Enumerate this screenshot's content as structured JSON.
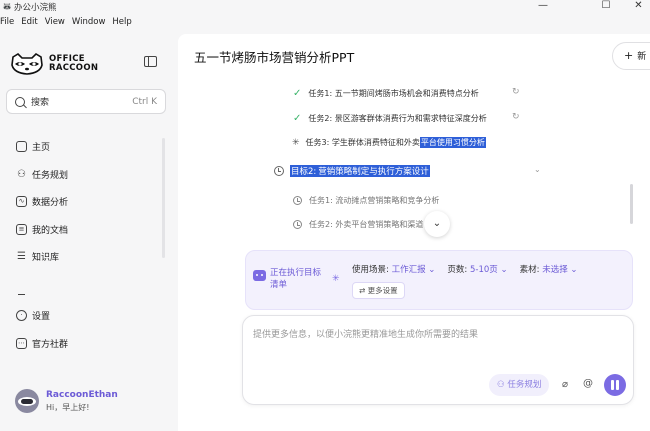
{
  "window": {
    "title": "办公小浣熊",
    "controls": [
      "—",
      "☐",
      "✕"
    ]
  },
  "menu": [
    "File",
    "Edit",
    "View",
    "Window",
    "Help"
  ],
  "sidebar": {
    "brand_line1": "OFFICE",
    "brand_line2": "RACCOON",
    "search_label": "搜索",
    "search_shortcut": "Ctrl K",
    "nav": [
      {
        "label": "主页",
        "icon": "home-icon"
      },
      {
        "label": "任务规划",
        "icon": "task-plan-icon"
      },
      {
        "label": "数据分析",
        "icon": "data-analysis-icon"
      },
      {
        "label": "我的文档",
        "icon": "document-icon"
      },
      {
        "label": "知识库",
        "icon": "knowledge-base-icon"
      }
    ],
    "bottom_nav": [
      {
        "label": "设置",
        "icon": "settings-icon"
      },
      {
        "label": "官方社群",
        "icon": "community-icon"
      }
    ],
    "user": {
      "name": "RaccoonEthan",
      "greeting": "Hi，早上好!"
    }
  },
  "main": {
    "title": "五一节烤肠市场营销分析PPT",
    "new_button": "新",
    "tasks_goal1": [
      {
        "text": "任务1: 五一节期间烤肠市场机会和消费特点分析",
        "status": "done"
      },
      {
        "text": "任务2: 景区游客群体消费行为和需求特征深度分析",
        "status": "done"
      },
      {
        "text_plain": "任务3: 学生群体消费特征和外卖",
        "text_hl": "平台使用习惯分析",
        "status": "running"
      }
    ],
    "goal2": {
      "prefix": "目标2:",
      "title": "营销策略制定与执行方案设计"
    },
    "tasks_goal2": [
      {
        "text": "任务1: 流动摊点营销策略和竞争分析"
      },
      {
        "text": "任务2: 外卖平台营销策略和渠道"
      }
    ],
    "status": {
      "executing_line1": "正在执行目标",
      "executing_line2": "清单",
      "scene_label": "使用场景:",
      "scene_value": "工作汇报",
      "pages_label": "页数:",
      "pages_value": "5-10页",
      "material_label": "素材:",
      "material_value": "未选择",
      "more_settings": "更多设置"
    },
    "input": {
      "placeholder": "提供更多信息，以便小浣熊更精准地生成你所需要的结果",
      "task_plan_button": "任务规划"
    }
  }
}
